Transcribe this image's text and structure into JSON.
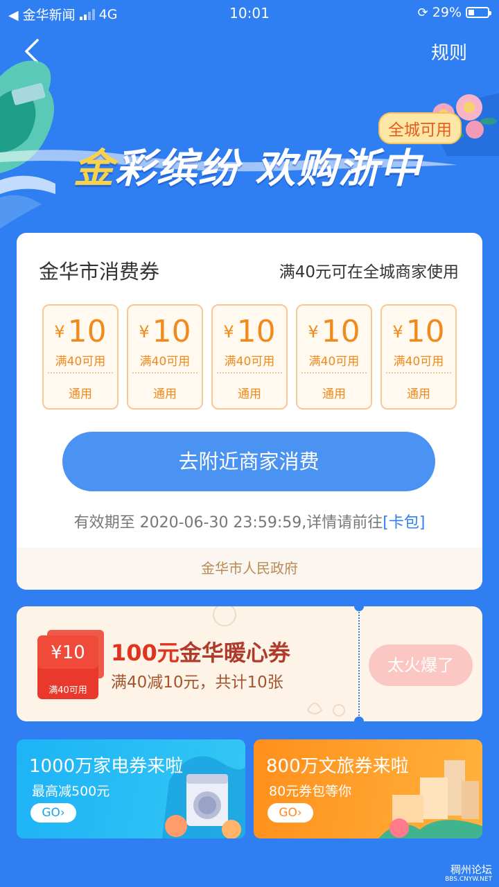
{
  "status_bar": {
    "carrier": "◀ 金华新闻",
    "network": "4G",
    "time": "10:01",
    "battery_text": "29%",
    "battery_level": 0.29
  },
  "header": {
    "rules_label": "规则"
  },
  "banner": {
    "title_gold": "金",
    "title_rest": "彩缤纷 欢购浙中",
    "badge": "全城可用"
  },
  "main_card": {
    "title": "金华市消费券",
    "subtitle": "满40元可在全城商家使用",
    "coupons": [
      {
        "currency": "¥",
        "amount": "10",
        "condition": "满40可用",
        "tag": "通用"
      },
      {
        "currency": "¥",
        "amount": "10",
        "condition": "满40可用",
        "tag": "通用"
      },
      {
        "currency": "¥",
        "amount": "10",
        "condition": "满40可用",
        "tag": "通用"
      },
      {
        "currency": "¥",
        "amount": "10",
        "condition": "满40可用",
        "tag": "通用"
      },
      {
        "currency": "¥",
        "amount": "10",
        "condition": "满40可用",
        "tag": "通用"
      }
    ],
    "action_label": "去附近商家消费",
    "validity_text": "有效期至 2020-06-30 23:59:59,详情请前往",
    "validity_link": "[卡包]",
    "footer": "金华市人民政府"
  },
  "warm_coupon": {
    "envelope_amount": "¥10",
    "envelope_condition": "满40可用",
    "title_red": "100元",
    "title_rest": "金华暖心券",
    "subtitle": "满40减10元，共计10张",
    "status_button": "太火爆了"
  },
  "tiles": [
    {
      "title": "1000万家电券来啦",
      "subtitle": "最高减500元",
      "go": "GO›"
    },
    {
      "title": "800万文旅券来啦",
      "subtitle": "80元券包等你",
      "go": "GO›"
    }
  ],
  "watermark": {
    "line1": "稠州论坛",
    "line2": "BBS.CNYW.NET"
  },
  "colors": {
    "background": "#2f7ff2",
    "coupon_orange": "#f08a1c",
    "primary_button": "#4b93f2",
    "warm_red": "#e0341f"
  }
}
